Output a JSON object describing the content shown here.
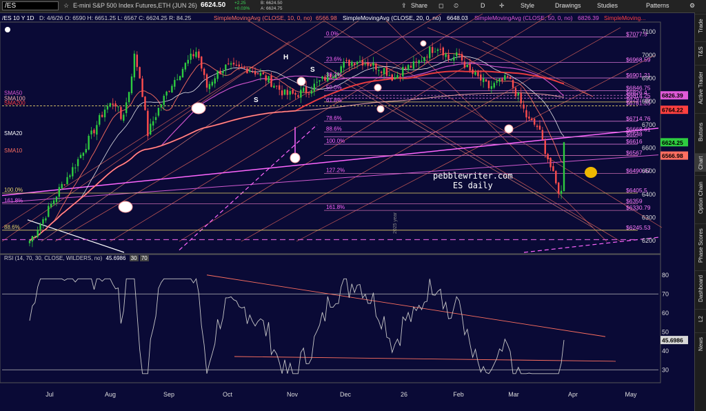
{
  "toolbar": {
    "symbol": "/ES",
    "description": "E-mini S&P 500 Index Futures,ETH (JUN 26)",
    "last_price": "6624.50",
    "change": "+2.25",
    "change_pct": "+0.03%",
    "bid": "B: 6624.50",
    "ask": "A: 6624.75",
    "share": "Share",
    "period": "D",
    "style": "Style",
    "drawings": "Drawings",
    "studies": "Studies",
    "patterns": "Patterns"
  },
  "infobar": {
    "range": "/ES 10 Y 1D",
    "ohlc": "D: 4/6/26   O: 6590   H: 6651.25   L: 6567   C: 6624.25   R: 84.25",
    "sma10": "SimpleMovingAvg (CLOSE, 10, 0, no)",
    "sma10_val": "6566.98",
    "sma20": "SimpleMovingAvg (CLOSE, 20, 0, no)",
    "sma20_val": "6648.03",
    "sma50": "SimpleMovingAvg (CLOSE, 50, 0, no)",
    "sma50_val": "6826.39",
    "sma_more": "SimpleMoving..."
  },
  "rsi": {
    "label": "RSI (14, 70, 30, CLOSE, WILDERS, no)",
    "value": "45.6986",
    "ob": "30",
    "os": "70"
  },
  "sidebar": [
    "Trade",
    "T&S",
    "Active Trader",
    "Buttons",
    "Chart",
    "Option Chain",
    "Phase Scores",
    "Dashboard",
    "L2",
    "News"
  ],
  "watermark": {
    "line1": "pebblewriter.com",
    "line2": "ES daily"
  },
  "colors": {
    "bg": "#0a0a36",
    "sma10": "#ff6f61",
    "sma20": "#ffffff",
    "sma50": "#e05ad8",
    "sma100": "#ff4040",
    "fib": "#ff66ff",
    "level": "#e8d36a",
    "up": "#2ecc40",
    "down": "#ff4d4d"
  },
  "chart_data": {
    "type": "candlestick",
    "x_ticks": [
      "Jul",
      "Aug",
      "Sep",
      "Oct",
      "Nov",
      "Dec",
      "26",
      "Feb",
      "Mar",
      "Apr",
      "May"
    ],
    "y_ticks": [
      6200,
      6300,
      6400,
      6500,
      6600,
      6700,
      6800,
      6900,
      7000,
      7100
    ],
    "ylim": [
      6150,
      7130
    ],
    "ma_labels": [
      "SMA50",
      "SMA100",
      "SMA200",
      "SMA20",
      "SMA10"
    ],
    "fib_labels": [
      {
        "label": "0.0%",
        "price": 7077.5
      },
      {
        "label": "23.6%",
        "price": 6968.59
      },
      {
        "label": "38.2%",
        "price": 6901.21
      },
      {
        "label": "50.0%",
        "price": 6846.75
      },
      {
        "label": "61.8%",
        "price": 6792
      },
      {
        "label": "78.6%",
        "price": 6714.76
      },
      {
        "label": "88.6%",
        "price": 6668
      },
      {
        "label": "100.0%",
        "price": 6616
      },
      {
        "label": "127.2%",
        "price": 6490.47
      },
      {
        "label": "161.8%",
        "price": 6330.79
      }
    ],
    "left_labels": [
      {
        "label": "100.0%",
        "price": 6405.5
      },
      {
        "label": "161.8%",
        "price": 6359
      },
      {
        "label": "88.6%",
        "price": 6245.53
      }
    ],
    "price_levels": [
      "$7077.5",
      "$6968.59",
      "$6901.21",
      "$6846.75",
      "$6826.4",
      "$6814.25",
      "$6797.75",
      "$6781.25",
      "$6714.76",
      "$6668.61",
      "$6648",
      "$6616",
      "$6567",
      "$6490.47",
      "$6405.5",
      "$6359",
      "$6330.79",
      "$6245.53"
    ],
    "price_tags": [
      {
        "value": "6826.39",
        "color": "#e05ad8"
      },
      {
        "value": "6764.22",
        "color": "#ff4040"
      },
      {
        "value": "6624.25",
        "color": "#2ecc40"
      },
      {
        "value": "6566.98",
        "color": "#ff6f61"
      }
    ],
    "rsi_ticks": [
      30,
      40,
      50,
      60,
      70,
      80
    ],
    "rsi_last": 45.6986,
    "annotation": "2025 year"
  }
}
